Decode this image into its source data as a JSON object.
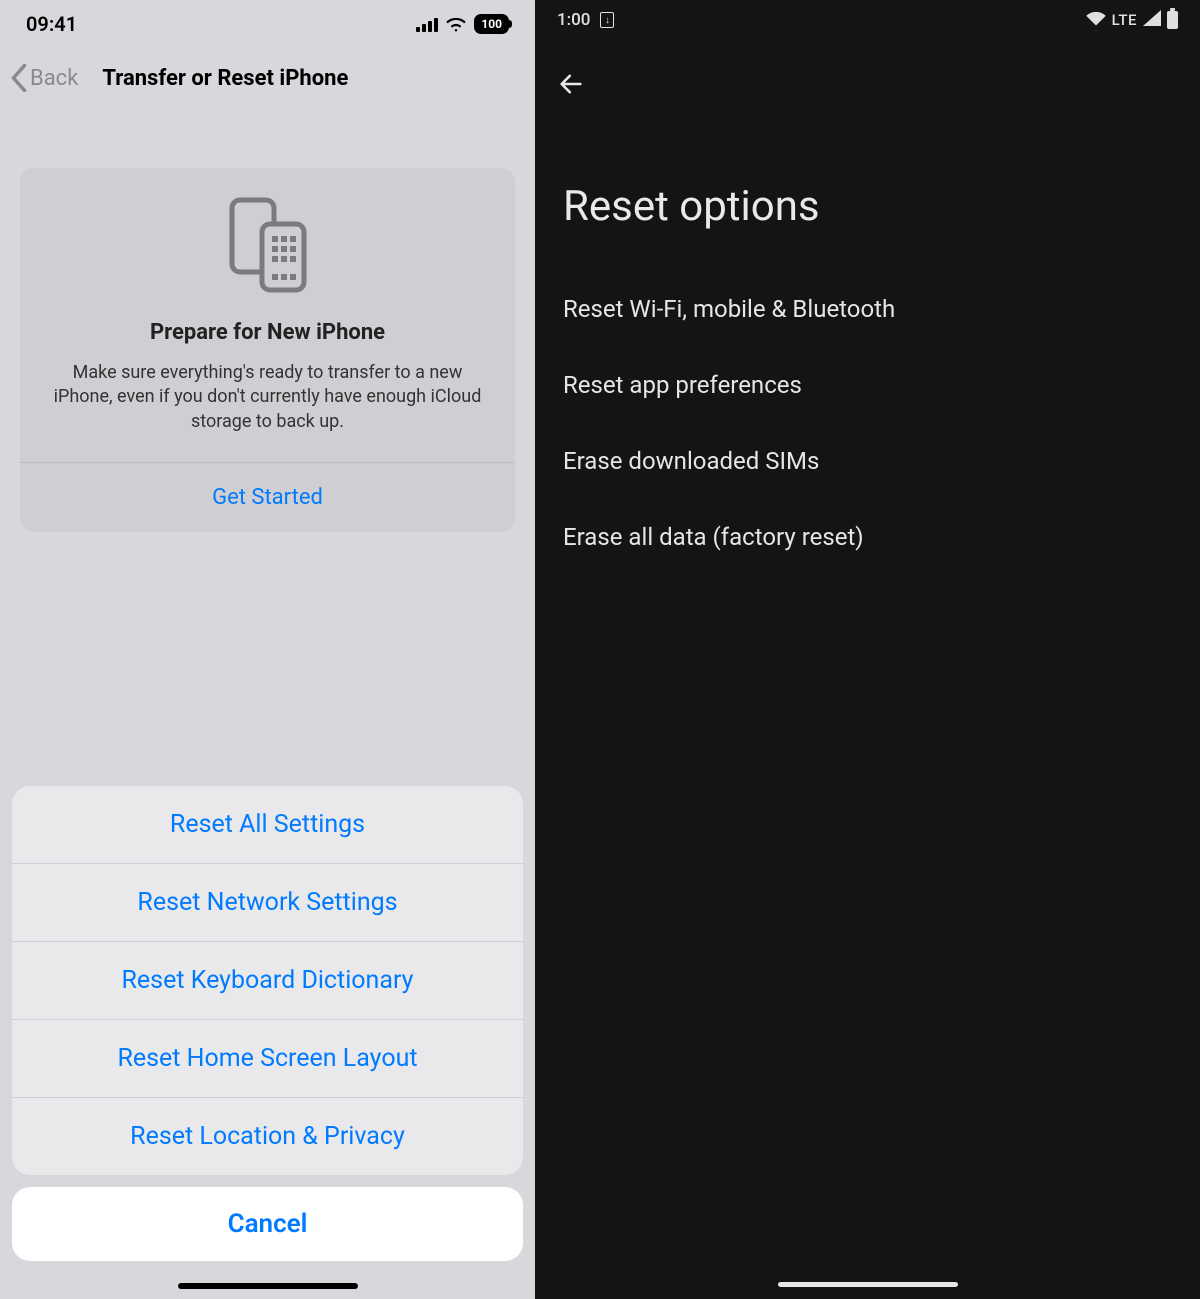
{
  "ios": {
    "status": {
      "time": "09:41",
      "battery": "100"
    },
    "nav": {
      "back": "Back",
      "title": "Transfer or Reset iPhone"
    },
    "card": {
      "title": "Prepare for New iPhone",
      "body": "Make sure everything's ready to transfer to a new iPhone, even if you don't currently have enough iCloud storage to back up.",
      "cta": "Get Started"
    },
    "sheet": {
      "items": [
        "Reset All Settings",
        "Reset Network Settings",
        "Reset Keyboard Dictionary",
        "Reset Home Screen Layout",
        "Reset Location & Privacy"
      ],
      "cancel": "Cancel"
    }
  },
  "android": {
    "status": {
      "time": "1:00",
      "net": "LTE"
    },
    "title": "Reset options",
    "items": [
      "Reset Wi-Fi, mobile & Bluetooth",
      "Reset app preferences",
      "Erase downloaded SIMs",
      "Erase all data (factory reset)"
    ]
  }
}
